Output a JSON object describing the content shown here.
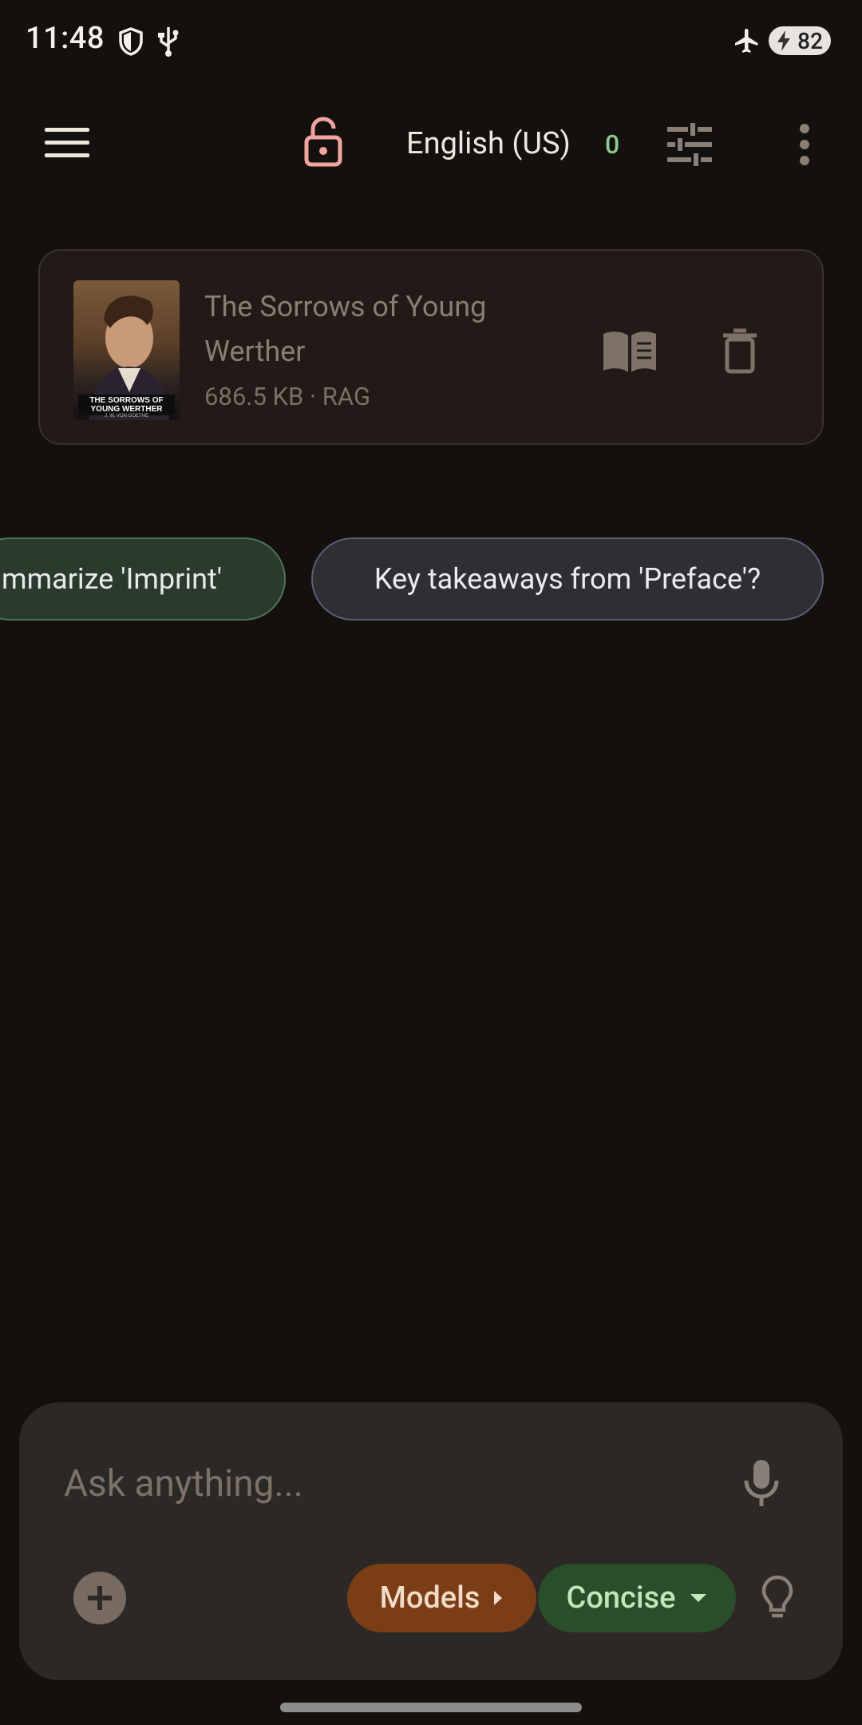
{
  "status_bar": {
    "time": "11:48",
    "battery_level": "82",
    "icons": [
      "shield-icon",
      "usb-icon",
      "airplane-mode-icon",
      "battery-charging-icon"
    ]
  },
  "top_bar": {
    "icons": [
      "menu-icon",
      "unlock-icon",
      "tune-icon",
      "more-vert-icon"
    ],
    "language": "English (US)",
    "count": "0",
    "count_color": "#8ec98e",
    "lock_color": "#f3a49f"
  },
  "document": {
    "title": "The Sorrows of Young Werther",
    "meta": "686.5 KB · RAG",
    "cover_title": "THE SORROWS OF YOUNG WERTHER",
    "cover_author": "J. W. VON GOETHE",
    "icons": [
      "book-open-icon",
      "trash-icon"
    ]
  },
  "suggestions": [
    {
      "label": "mmarize 'Imprint'"
    },
    {
      "label": "Key takeaways from 'Preface'?"
    }
  ],
  "composer": {
    "placeholder": "Ask anything...",
    "models_label": "Models",
    "concise_label": "Concise",
    "icons": [
      "microphone-icon",
      "add-circle-icon",
      "arrow-right-icon",
      "dropdown-arrow-icon",
      "lightbulb-icon"
    ]
  },
  "colors": {
    "background": "#13100e",
    "card": "#211a16",
    "models_button": "#7a3d16",
    "concise_button": "#2a4e2a"
  }
}
